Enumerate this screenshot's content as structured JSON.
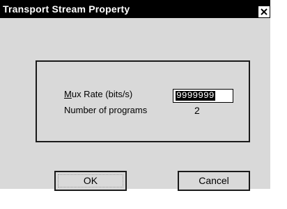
{
  "window": {
    "title": "Transport Stream Property"
  },
  "form": {
    "mux_rate_label_mnemonic": "M",
    "mux_rate_label_rest": "ux Rate (bits/s)",
    "mux_rate_value": "9999999",
    "programs_label": "Number of programs",
    "programs_value": "2"
  },
  "buttons": {
    "ok": "OK",
    "cancel": "Cancel"
  }
}
